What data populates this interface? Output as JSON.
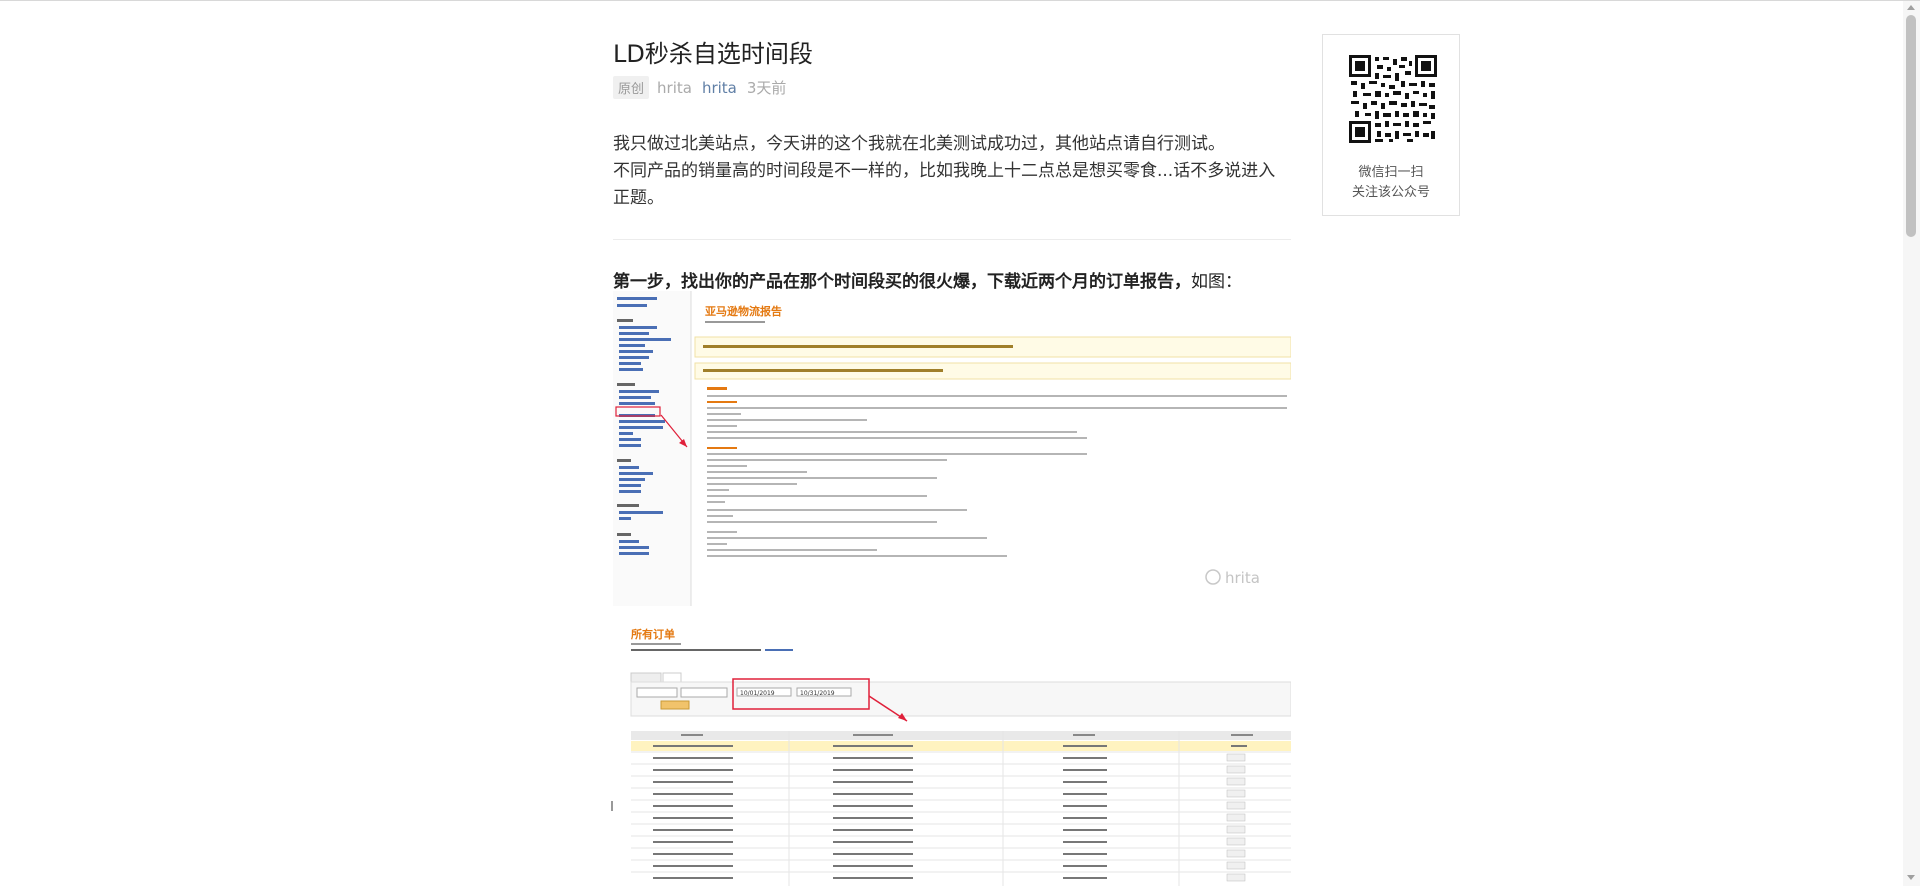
{
  "article": {
    "title": "LD秒杀自选时间段",
    "badge": "原创",
    "author": "hrita",
    "account": "hrita",
    "time": "3天前",
    "intro_line1": "我只做过北美站点，今天讲的这个我就在北美测试成功过，其他站点请自行测试。",
    "intro_line2": "不同产品的销量高的时间段是不一样的，比如我晚上十二点总是想买零食...话不多说进入正题。",
    "step_bold": "第一步，找出你的产品在那个时间段买的很火爆，下载近两个月的订单报告，",
    "step_tail": "如图："
  },
  "qr": {
    "line1": "微信扫一扫",
    "line2": "关注该公众号"
  },
  "figure1": {
    "header_title": "亚马逊物流报告",
    "watermark": "hrita"
  },
  "figure2": {
    "header_title": "所有订单",
    "date_from": "10/01/2019",
    "date_to": "10/31/2019"
  }
}
